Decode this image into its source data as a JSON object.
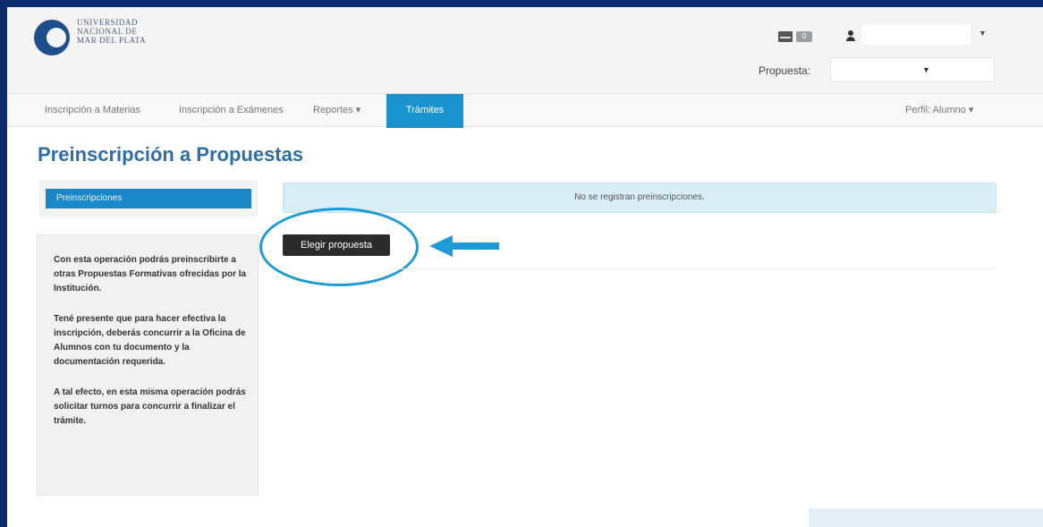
{
  "header": {
    "logo_lines": [
      "Universidad",
      "Nacional de",
      "Mar del Plata"
    ],
    "messages_count": "0",
    "propuesta_label": "Propuesta:"
  },
  "navbar": {
    "items": [
      "Inscripción a Materias",
      "Inscripción a Exámenes",
      "Reportes ▾",
      "Trámites"
    ],
    "active": "Trámites",
    "profile": "Perfil: Alumno ▾"
  },
  "page": {
    "title": "Preinscripción a Propuestas"
  },
  "sidebar": {
    "nav_item": "Preinscripciones",
    "info_paragraphs": [
      "Con esta operación podrás preinscribirte a otras Propuestas Formativas ofrecidas por la Institución.",
      "Tené presente que para hacer efectiva la inscripción, deberás concurrir a la Oficina de Alumnos con tu documento y la documentación requerida.",
      "A tal efecto, en esta misma operación podrás solicitar turnos para concurrir a finalizar el trámite."
    ]
  },
  "main": {
    "alert": "No se registran preinscripciones.",
    "button": "Elegir propuesta"
  },
  "colors": {
    "frame": "#0b2a6e",
    "accent": "#1a93cf",
    "title": "#2e6ea8",
    "annotation": "#1e9ad6"
  },
  "icons": [
    "envelope-icon",
    "user-icon",
    "caret-down-icon",
    "arrow-left-icon"
  ]
}
